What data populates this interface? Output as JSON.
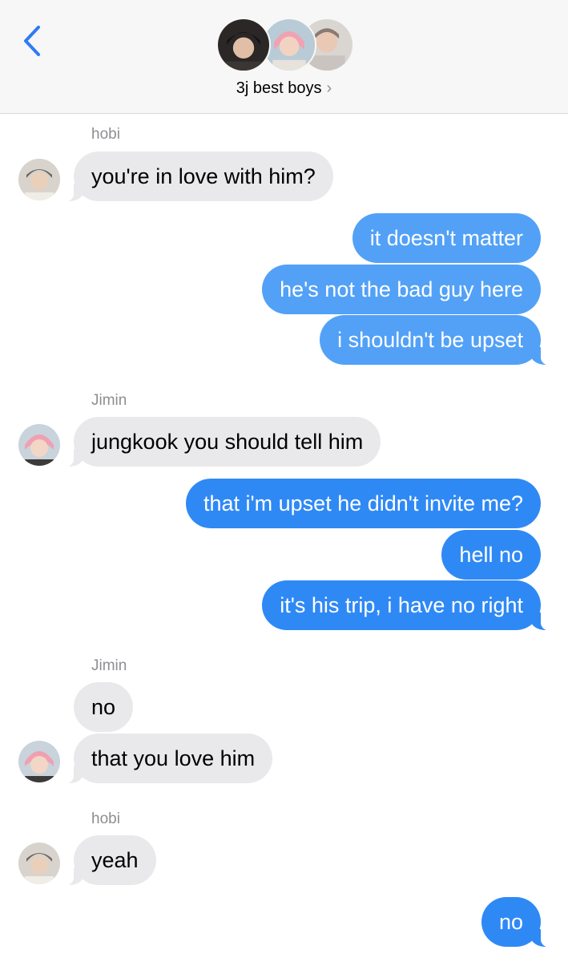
{
  "header": {
    "group_name": "3j best boys",
    "chevron": "›",
    "icons": {
      "back": "back-chevron-icon",
      "details": "chevron-right-icon"
    }
  },
  "colors": {
    "outgoing": "#2f89f5",
    "outgoing_light": "#52a1f7",
    "incoming": "#e9e9eb",
    "accent": "#2f7bf5"
  },
  "messages": [
    {
      "sender": "hobi",
      "text": "you're in love with him?"
    },
    {
      "text": "it doesn't matter"
    },
    {
      "text": "he's not the bad guy here"
    },
    {
      "text": "i shouldn't be upset"
    },
    {
      "sender": "Jimin",
      "text": "jungkook you should tell him"
    },
    {
      "text": "that i'm upset he didn't invite me?"
    },
    {
      "text": "hell no"
    },
    {
      "text": "it's his trip, i have no right"
    },
    {
      "sender": "Jimin",
      "text": "no"
    },
    {
      "text": "that you love him"
    },
    {
      "sender": "hobi",
      "text": "yeah"
    },
    {
      "text": "no"
    }
  ]
}
